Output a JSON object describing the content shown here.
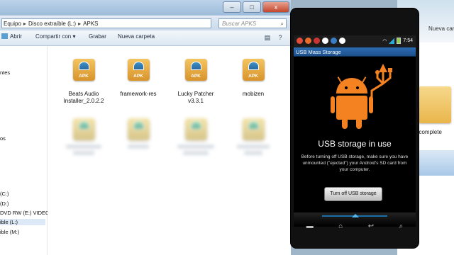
{
  "explorer": {
    "window_buttons": {
      "minimize": "–",
      "maximize": "□",
      "close": "x"
    },
    "breadcrumb": [
      "Equipo",
      "Disco extraíble (L:)",
      "APKS"
    ],
    "search_placeholder": "Buscar APKS",
    "toolbar": {
      "open": "Abrir",
      "share": "Compartir con ▾",
      "burn": "Grabar",
      "new_folder": "Nueva carpeta"
    },
    "nav_items": [
      "ntes",
      "os",
      "(C:)",
      "(D:)",
      "DVD RW (E:) VIDEO_I",
      "ible (L:)",
      "ible (M:)"
    ],
    "files": [
      {
        "name": "Beats Audio Installer_2.0.2.2",
        "icon": "apk-icon"
      },
      {
        "name": "framework-res",
        "icon": "apk-icon"
      },
      {
        "name": "Lucky Patcher v3.3.1",
        "icon": "apk-icon"
      },
      {
        "name": "mobizen",
        "icon": "apk-icon"
      }
    ],
    "apk_label": "APK"
  },
  "background_window": {
    "new_folder": "Nueva carpeta",
    "item_label": "ncomplete"
  },
  "phone": {
    "status_time": "7:54",
    "app_title": "USB Mass Storage",
    "heading": "USB storage in use",
    "description": "Before turning off USB storage, make sure you have unmounted (\"ejected\") your Android's SD card from your computer.",
    "button": "Turn off USB storage",
    "colors": {
      "android_orange": "#f58220",
      "title_blue": "#2d6db3"
    }
  }
}
